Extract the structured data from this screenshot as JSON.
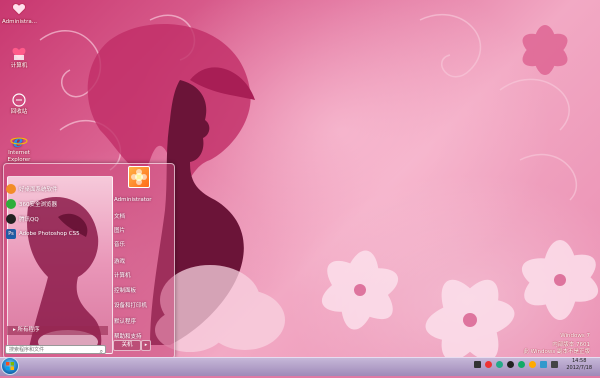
{
  "desktop": {
    "icons": [
      {
        "label": "Administra...",
        "icon": "user-folder-icon"
      },
      {
        "label": "计算机",
        "icon": "computer-icon"
      },
      {
        "label": "回收站",
        "icon": "recycle-bin-icon"
      },
      {
        "label": "Internet Explorer",
        "icon": "internet-explorer-icon"
      }
    ]
  },
  "start_menu": {
    "pinned": [
      {
        "label": "好桌面系统软件",
        "icon": "app-orange-icon",
        "color": "#f28c28"
      },
      {
        "label": "360安全浏览器",
        "icon": "browser-green-icon",
        "color": "#2eae3a"
      },
      {
        "label": "腾讯QQ",
        "icon": "qq-penguin-icon",
        "color": "#222222"
      },
      {
        "label": "Adobe Photoshop CS5",
        "icon": "photoshop-icon",
        "color": "#1d5fa8"
      }
    ],
    "all_programs": "所有程序",
    "search_placeholder": "搜索程序和文件",
    "right_items": [
      "Administrator",
      "文档",
      "图片",
      "音乐",
      "游戏",
      "计算机",
      "控制面板",
      "设备和打印机",
      "默认程序",
      "帮助和支持"
    ],
    "shutdown_label": "关机"
  },
  "watermark": {
    "line1": "Windows 7",
    "line2": "内部版本 7601",
    "line3": "此 Windows 副本不是正版"
  },
  "taskbar": {
    "time": "14:58",
    "date": "2012/7/18"
  }
}
